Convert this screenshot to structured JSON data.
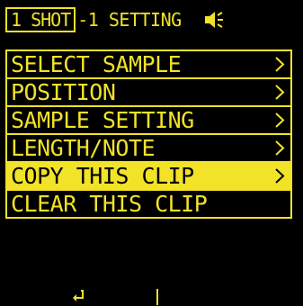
{
  "header": {
    "mode": "1 SHOT",
    "title": "-1 SETTING",
    "speaker_icon": "speaker-icon"
  },
  "menu": {
    "items": [
      {
        "label": "SELECT SAMPLE",
        "has_arrow": true,
        "selected": false
      },
      {
        "label": "POSITION",
        "has_arrow": true,
        "selected": false
      },
      {
        "label": "SAMPLE SETTING",
        "has_arrow": true,
        "selected": false
      },
      {
        "label": "LENGTH/NOTE",
        "has_arrow": true,
        "selected": false
      },
      {
        "label": "COPY THIS CLIP",
        "has_arrow": true,
        "selected": true
      },
      {
        "label": "CLEAR THIS CLIP",
        "has_arrow": false,
        "selected": false
      }
    ]
  },
  "bottom_bar": {
    "left_icon": "return-icon",
    "right_label": ""
  },
  "colors": {
    "accent": "#f2e228",
    "background": "#000000"
  }
}
